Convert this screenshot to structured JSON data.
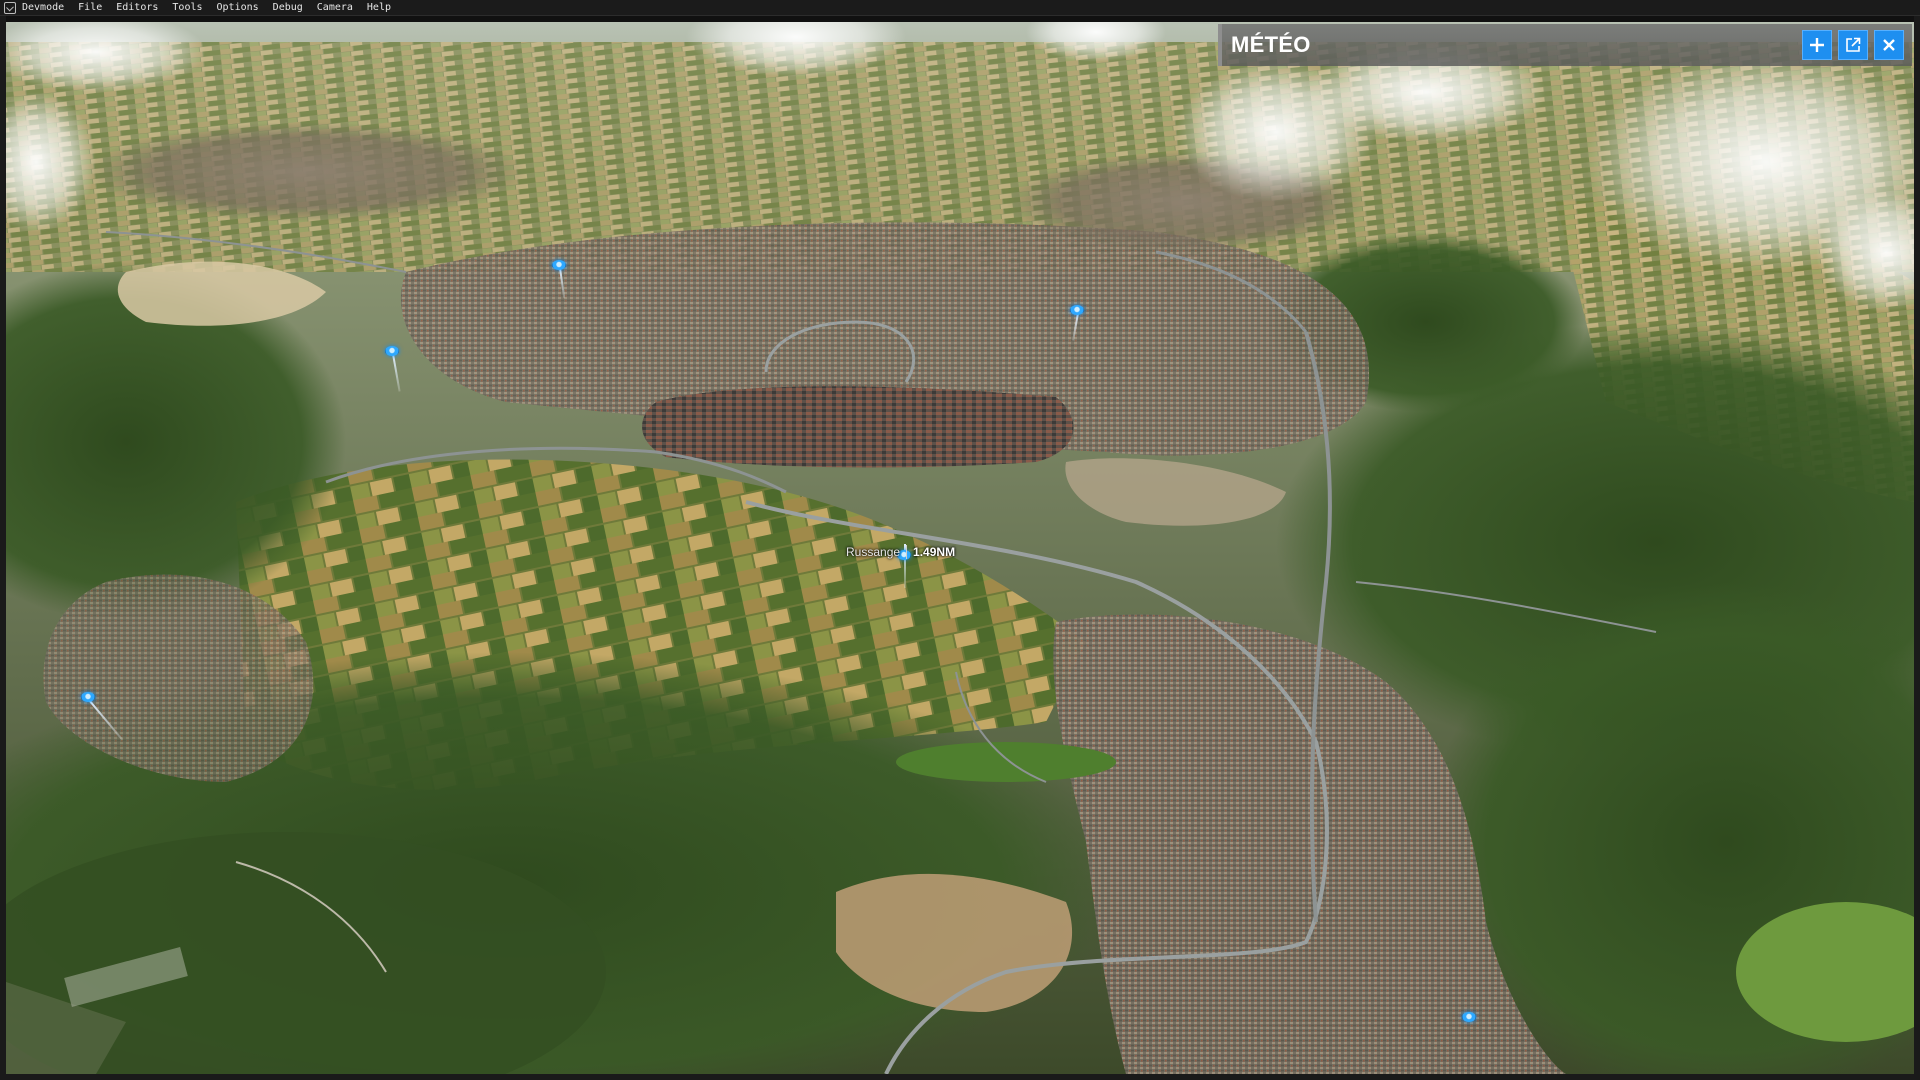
{
  "menubar": {
    "app_label": "Devmode",
    "items": [
      "File",
      "Editors",
      "Tools",
      "Options",
      "Debug",
      "Camera",
      "Help"
    ]
  },
  "meteo_panel": {
    "title": "MÉTÉO",
    "buttons": [
      {
        "icon": "plus-icon"
      },
      {
        "icon": "external-window-icon"
      },
      {
        "icon": "close-icon"
      }
    ],
    "accent_color": "#1e8ff0"
  },
  "place_label": {
    "name": "Russange",
    "distance": "1.49NM"
  }
}
